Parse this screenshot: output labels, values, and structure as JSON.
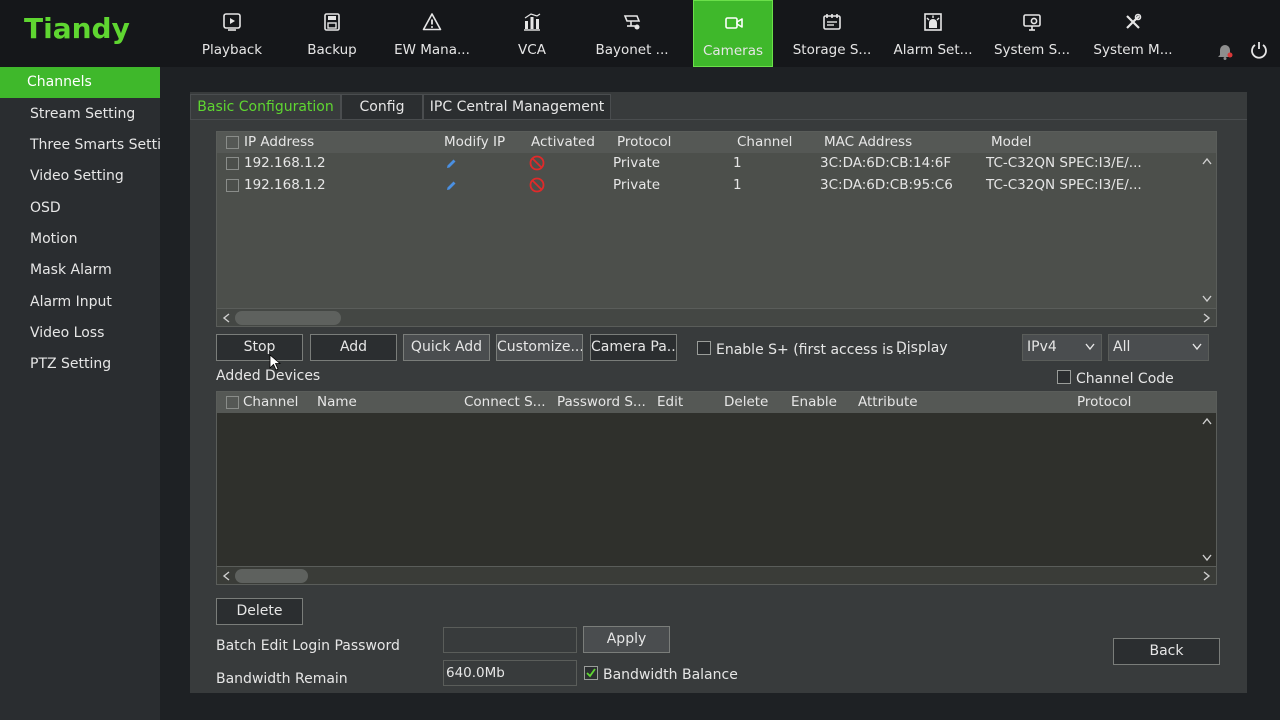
{
  "brand": {
    "name": "Tiandy",
    "color": "#5fd631",
    "accent": "#3fb82b"
  },
  "nav": [
    {
      "label": "Playback",
      "icon": "playback-icon"
    },
    {
      "label": "Backup",
      "icon": "backup-icon"
    },
    {
      "label": "EW Mana...",
      "icon": "warning-icon"
    },
    {
      "label": "VCA",
      "icon": "vca-chart-icon"
    },
    {
      "label": "Bayonet ...",
      "icon": "bayonet-camera-icon"
    },
    {
      "label": "Cameras",
      "icon": "camera-icon",
      "active": true
    },
    {
      "label": "Storage S...",
      "icon": "storage-icon"
    },
    {
      "label": "Alarm Set...",
      "icon": "alarm-icon"
    },
    {
      "label": "System S...",
      "icon": "system-settings-icon"
    },
    {
      "label": "System M...",
      "icon": "tools-icon"
    }
  ],
  "sidebar": [
    {
      "label": "Channels",
      "active": true
    },
    {
      "label": "Stream Setting"
    },
    {
      "label": "Three Smarts Setti..."
    },
    {
      "label": "Video Setting"
    },
    {
      "label": "OSD"
    },
    {
      "label": "Motion"
    },
    {
      "label": "Mask Alarm"
    },
    {
      "label": "Alarm Input"
    },
    {
      "label": "Video Loss"
    },
    {
      "label": "PTZ Setting"
    }
  ],
  "tabs": [
    {
      "label": "Basic Configuration",
      "active": true
    },
    {
      "label": "Config"
    },
    {
      "label": "IPC Central Management"
    }
  ],
  "discovered": {
    "columns": [
      "IP Address",
      "Modify IP",
      "Activated",
      "Protocol",
      "Channel",
      "MAC Address",
      "Model"
    ],
    "rows": [
      {
        "ip": "192.168.1.2",
        "protocol": "Private",
        "channel": "1",
        "mac": "3C:DA:6D:CB:14:6F",
        "model": "TC-C32QN SPEC:I3/E/..."
      },
      {
        "ip": "192.168.1.2",
        "protocol": "Private",
        "channel": "1",
        "mac": "3C:DA:6D:CB:95:C6",
        "model": "TC-C32QN SPEC:I3/E/..."
      }
    ]
  },
  "toolbar": {
    "stop": "Stop",
    "add": "Add",
    "quick_add": "Quick Add",
    "customize": "Customize...",
    "camera_pa": "Camera Pa...",
    "enable_s_plus": "Enable S+ (first access is ...",
    "display": "Display",
    "ip_version": "IPv4",
    "filter": "All"
  },
  "added": {
    "title": "Added Devices",
    "channel_code": "Channel Code",
    "columns": [
      "Channel",
      "Name",
      "Connect S...",
      "Password S...",
      "Edit",
      "Delete",
      "Enable",
      "Attribute",
      "Protocol"
    ]
  },
  "footer": {
    "delete": "Delete",
    "batch_label": "Batch Edit Login Password",
    "batch_value": "",
    "apply": "Apply",
    "bandwidth_label": "Bandwidth Remain",
    "bandwidth_value": "640.0Mb",
    "bandwidth_balance": "Bandwidth Balance",
    "back": "Back"
  }
}
